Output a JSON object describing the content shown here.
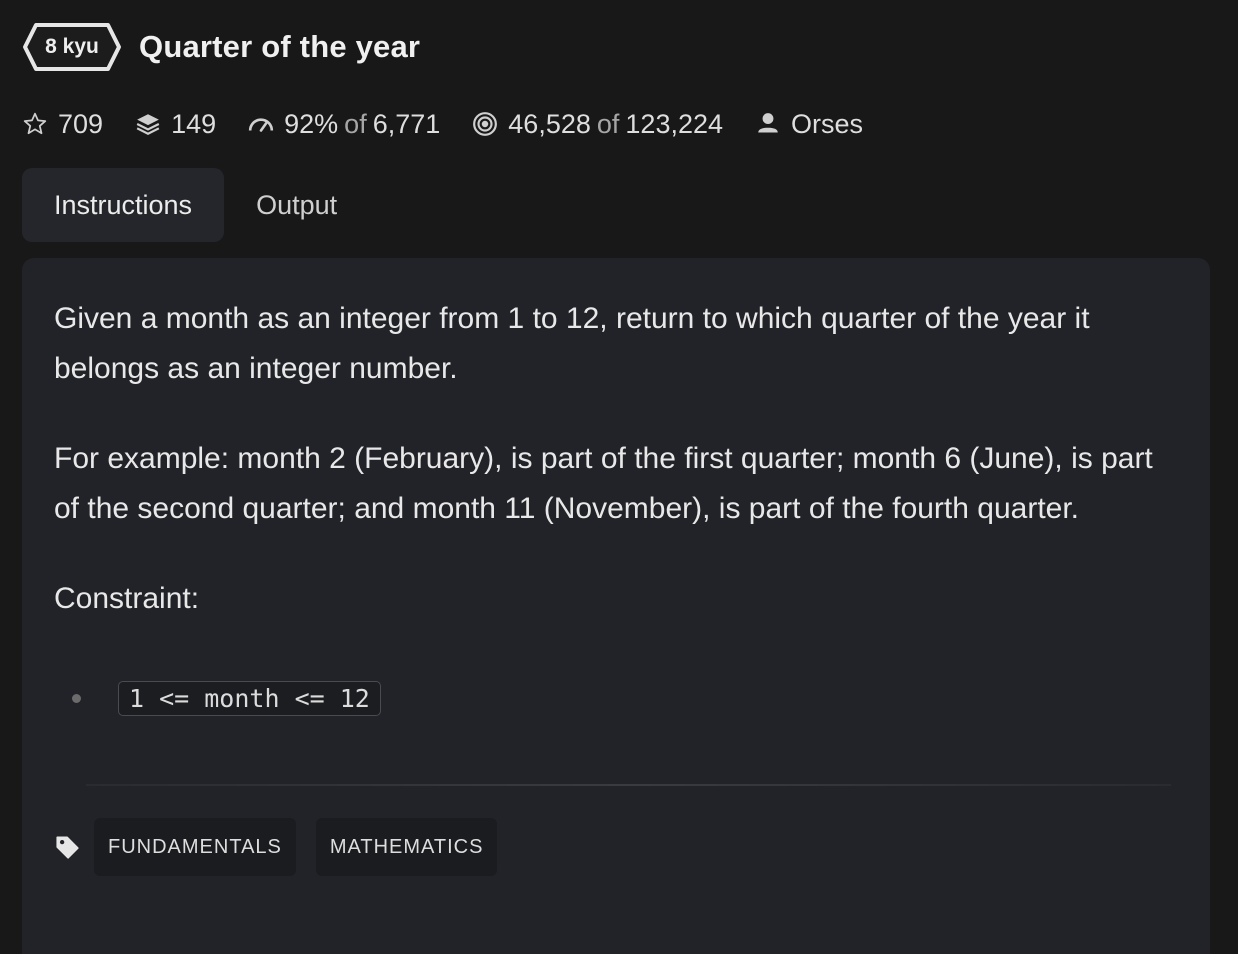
{
  "kata": {
    "rank": "8 kyu",
    "title": "Quarter of the year"
  },
  "stats": {
    "stars": "709",
    "collections": "149",
    "satisfaction_pct": "92%",
    "satisfaction_of": "of",
    "satisfaction_votes": "6,771",
    "completed": "46,528",
    "completed_of": "of",
    "attempts": "123,224",
    "author": "Orses"
  },
  "tabs": [
    {
      "label": "Instructions",
      "active": true
    },
    {
      "label": "Output",
      "active": false
    }
  ],
  "description": {
    "paragraph_1": "Given a month as an integer from 1 to 12, return to which quarter of the year it belongs as an integer number.",
    "paragraph_2": "For example: month 2 (February), is part of the first quarter; month 6 (June), is part of the second quarter; and month 11 (November), is part of the fourth quarter.",
    "constraint_heading": "Constraint:",
    "constraints": [
      "1 <= month <= 12"
    ]
  },
  "tags": [
    "FUNDAMENTALS",
    "MATHEMATICS"
  ],
  "icons": {
    "star": "star-icon",
    "collections": "layers-icon",
    "satisfaction": "gauge-icon",
    "completed": "target-icon",
    "author": "user-icon",
    "tags": "tag-icon"
  },
  "colors": {
    "background": "#181818",
    "panel": "#222328",
    "active_tab": "#25262b",
    "badge_border": "#e6e6e6"
  }
}
